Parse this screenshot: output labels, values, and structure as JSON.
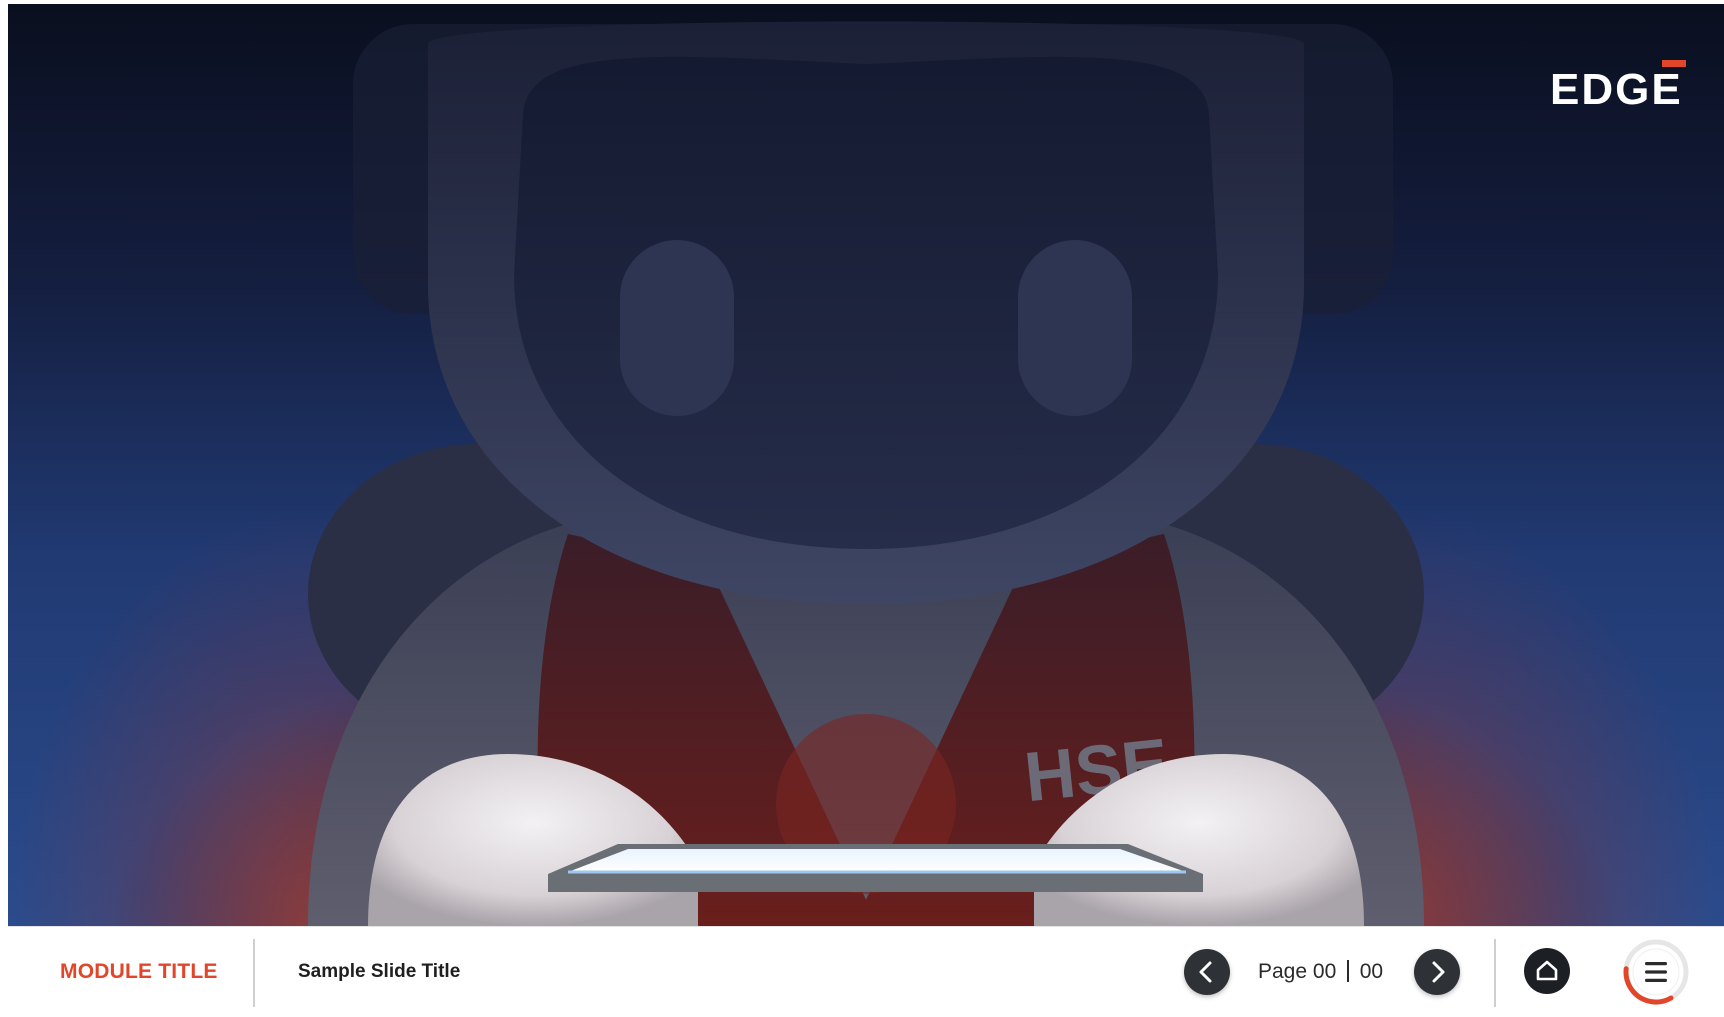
{
  "brand": {
    "logo_text": "EDGE",
    "accent_color": "#e2462a"
  },
  "hero": {
    "badge_text": "HSE"
  },
  "footer": {
    "module_title": "MODULE TITLE",
    "slide_title": "Sample Slide Title",
    "page_label": "Page",
    "page_current": "00",
    "page_total": "00",
    "prev_icon": "chevron-left-icon",
    "next_icon": "chevron-right-icon",
    "home_icon": "home-icon",
    "menu_icon": "hamburger-menu-icon",
    "menu_progress": 0.35
  }
}
